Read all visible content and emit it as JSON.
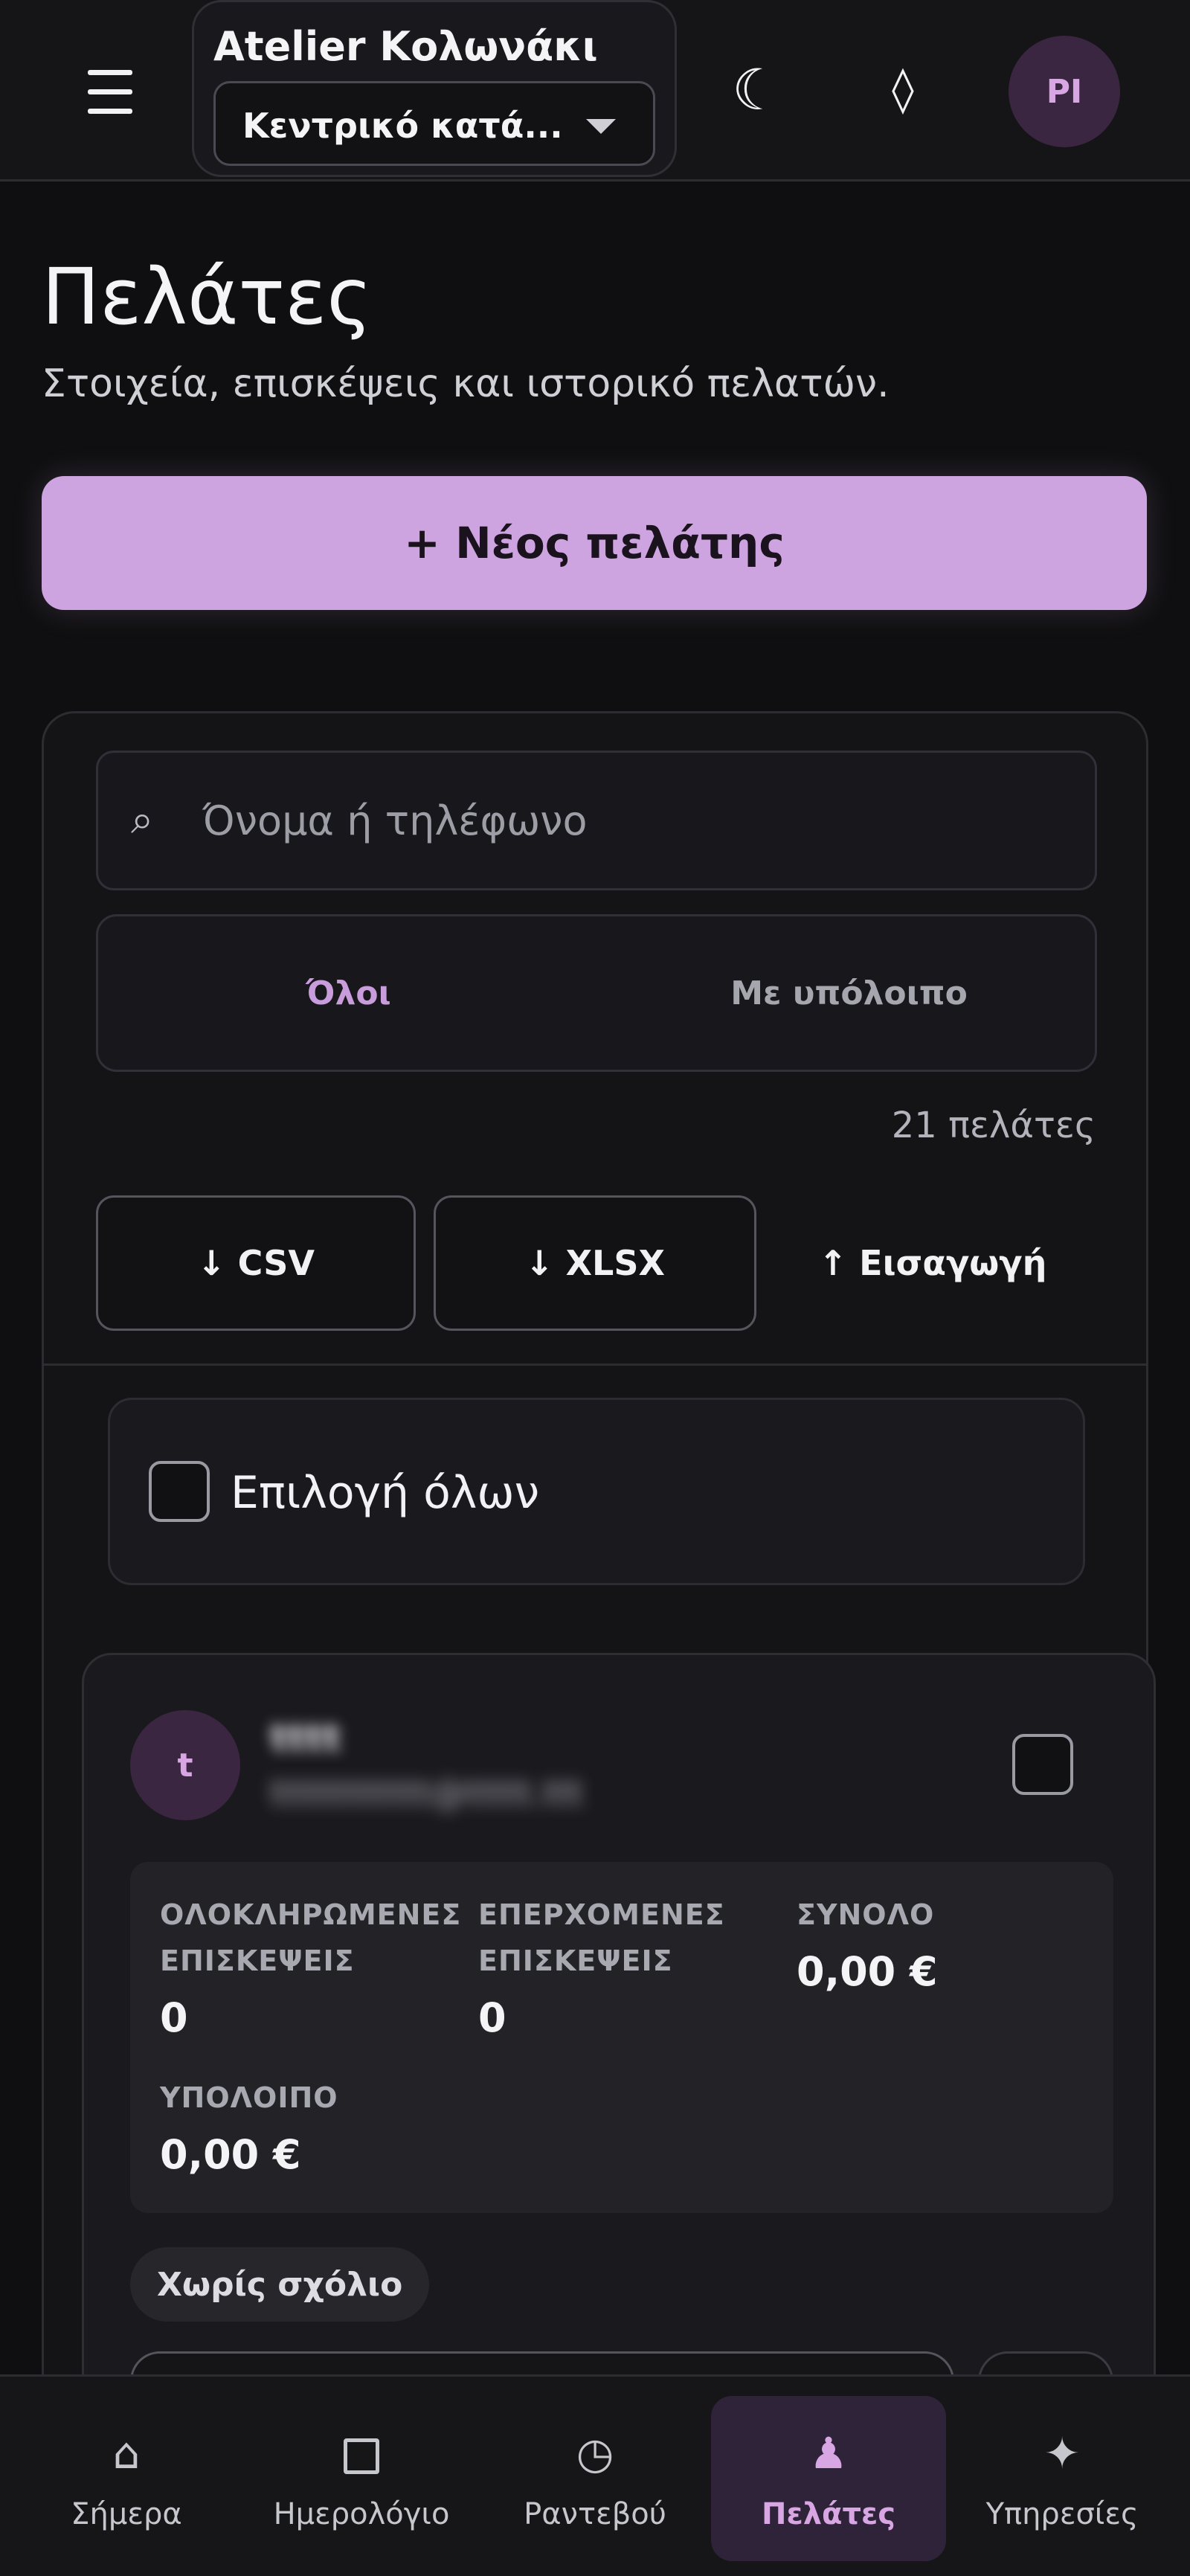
{
  "header": {
    "salon_name": "Atelier Κολωνάκι",
    "branch_value": "Κεντρικό κατά...",
    "avatar_initials": "PI",
    "icons": [
      "menu-icon",
      "moon-icon",
      "diamond-icon"
    ]
  },
  "page": {
    "title": "Πελάτες",
    "subtitle": "Στοιχεία, επισκέψεις και ιστορικό πελατών.",
    "new_client_label": "+ Νέος πελάτης"
  },
  "filters": {
    "search_placeholder": "Όνομα ή τηλέφωνο",
    "tabs": [
      {
        "label": "Όλοι",
        "active": true
      },
      {
        "label": "Με υπόλοιπο",
        "active": false
      }
    ],
    "count_text": "21 πελάτες",
    "export_csv": "↓ CSV",
    "export_xlsx": "↓ XLSX",
    "import_label": "↑ Εισαγωγή",
    "select_all_label": "Επιλογή όλων"
  },
  "client": {
    "avatar_initial": "t",
    "name": "tttt",
    "email": "tttttttttttt@ttttt.ttt",
    "stats": [
      {
        "label": "ΟΛΟΚΛΗΡΩΜΕΝΕΣ ΕΠΙΣΚΕΨΕΙΣ",
        "value": "0"
      },
      {
        "label": "ΕΠΕΡΧΟΜΕΝΕΣ ΕΠΙΣΚΕΨΕΙΣ",
        "value": "0"
      },
      {
        "label": "ΣΥΝΟΛΟ",
        "value": "0,00 €"
      },
      {
        "label": "ΥΠΟΛΟΙΠΟ",
        "value": "0,00 €"
      }
    ],
    "note_chip": "Χωρίς σχόλιο"
  },
  "bottom_nav": [
    {
      "label": "Σήμερα",
      "icon": "home-icon",
      "active": false
    },
    {
      "label": "Ημερολόγιο",
      "icon": "calendar-icon",
      "active": false
    },
    {
      "label": "Ραντεβού",
      "icon": "clock-icon",
      "active": false
    },
    {
      "label": "Πελάτες",
      "icon": "client-icon",
      "active": true
    },
    {
      "label": "Υπηρεσίες",
      "icon": "sparkle-icon",
      "active": false
    }
  ],
  "colors": {
    "accent": "#cda4e0",
    "accent_text": "#c99ddc",
    "background": "#0f0f11",
    "card": "#141417"
  }
}
